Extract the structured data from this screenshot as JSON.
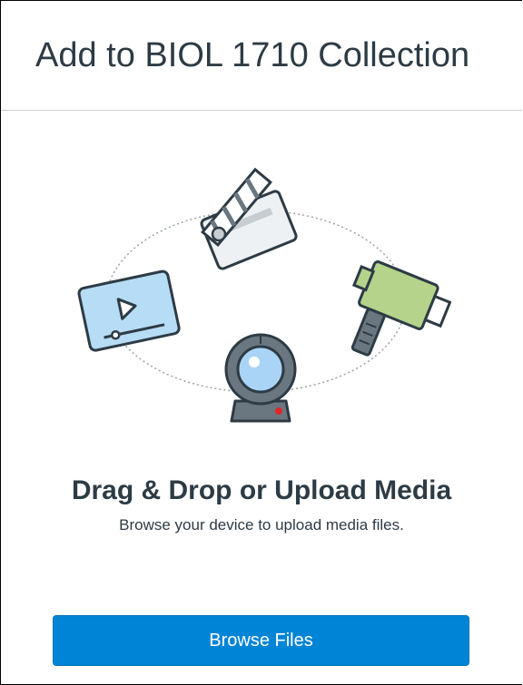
{
  "header": {
    "title": "Add to BIOL 1710 Collection"
  },
  "dropzone": {
    "heading": "Drag & Drop or Upload Media",
    "subtext": "Browse your device to upload media files.",
    "browse_label": "Browse Files",
    "illustration_icons": [
      "clapperboard-icon",
      "video-player-icon",
      "camcorder-icon",
      "webcam-icon"
    ]
  },
  "colors": {
    "title_text": "#2d3b45",
    "button_bg": "#0084d5",
    "button_text": "#ffffff",
    "divider": "#c7cdd1",
    "video_icon_fill": "#b7dcf5",
    "camcorder_fill": "#b5d38a",
    "webcam_lens": "#a9d4f5",
    "webcam_led": "#e0262b"
  }
}
